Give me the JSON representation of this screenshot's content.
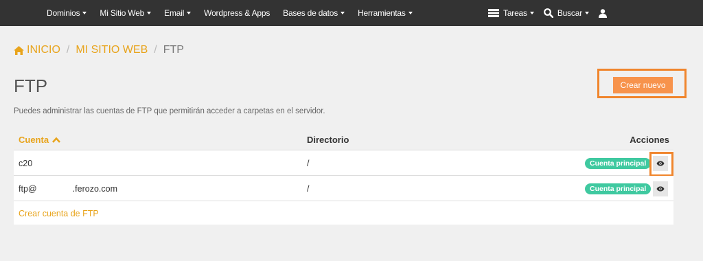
{
  "topnav": {
    "menus": [
      {
        "label": "Dominios"
      },
      {
        "label": "Mi Sitio Web"
      },
      {
        "label": "Email"
      },
      {
        "label": "Wordpress & Apps"
      },
      {
        "label": "Bases de datos"
      },
      {
        "label": "Herramientas"
      }
    ],
    "right": {
      "tasks_label": "Tareas",
      "search_label": "Buscar"
    }
  },
  "breadcrumb": {
    "home_label": "INICIO",
    "site_label": "MI SITIO WEB",
    "current_label": "FTP"
  },
  "page": {
    "title": "FTP",
    "create_button": "Crear nuevo",
    "description": "Puedes administrar las cuentas de FTP que permitirán acceder a carpetas en el servidor."
  },
  "table": {
    "columns": {
      "account": "Cuenta",
      "directory": "Directorio",
      "actions": "Acciones"
    },
    "rows": [
      {
        "account": "c20",
        "directory": "/",
        "badge": "Cuenta principal"
      },
      {
        "account": "ftp@               .ferozo.com",
        "directory": "/",
        "badge": "Cuenta principal"
      }
    ],
    "create_link": "Crear cuenta de FTP"
  },
  "colors": {
    "accent": "#e8a41c",
    "button": "#f7934c",
    "highlight": "#f0852c",
    "badge": "#3fc9a0",
    "navbar": "#333333"
  }
}
